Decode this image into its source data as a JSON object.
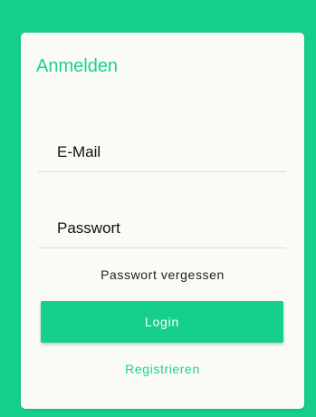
{
  "colors": {
    "background": "#16cf8c",
    "card": "#fafaf7",
    "accent": "#1bd193",
    "button_text": "#ffffff"
  },
  "login_card": {
    "title": "Anmelden",
    "email": {
      "placeholder": "E-Mail",
      "value": ""
    },
    "password": {
      "placeholder": "Passwort",
      "value": ""
    },
    "forgot_password_label": "Passwort vergessen",
    "login_label": "Login",
    "register_label": "Registrieren"
  }
}
